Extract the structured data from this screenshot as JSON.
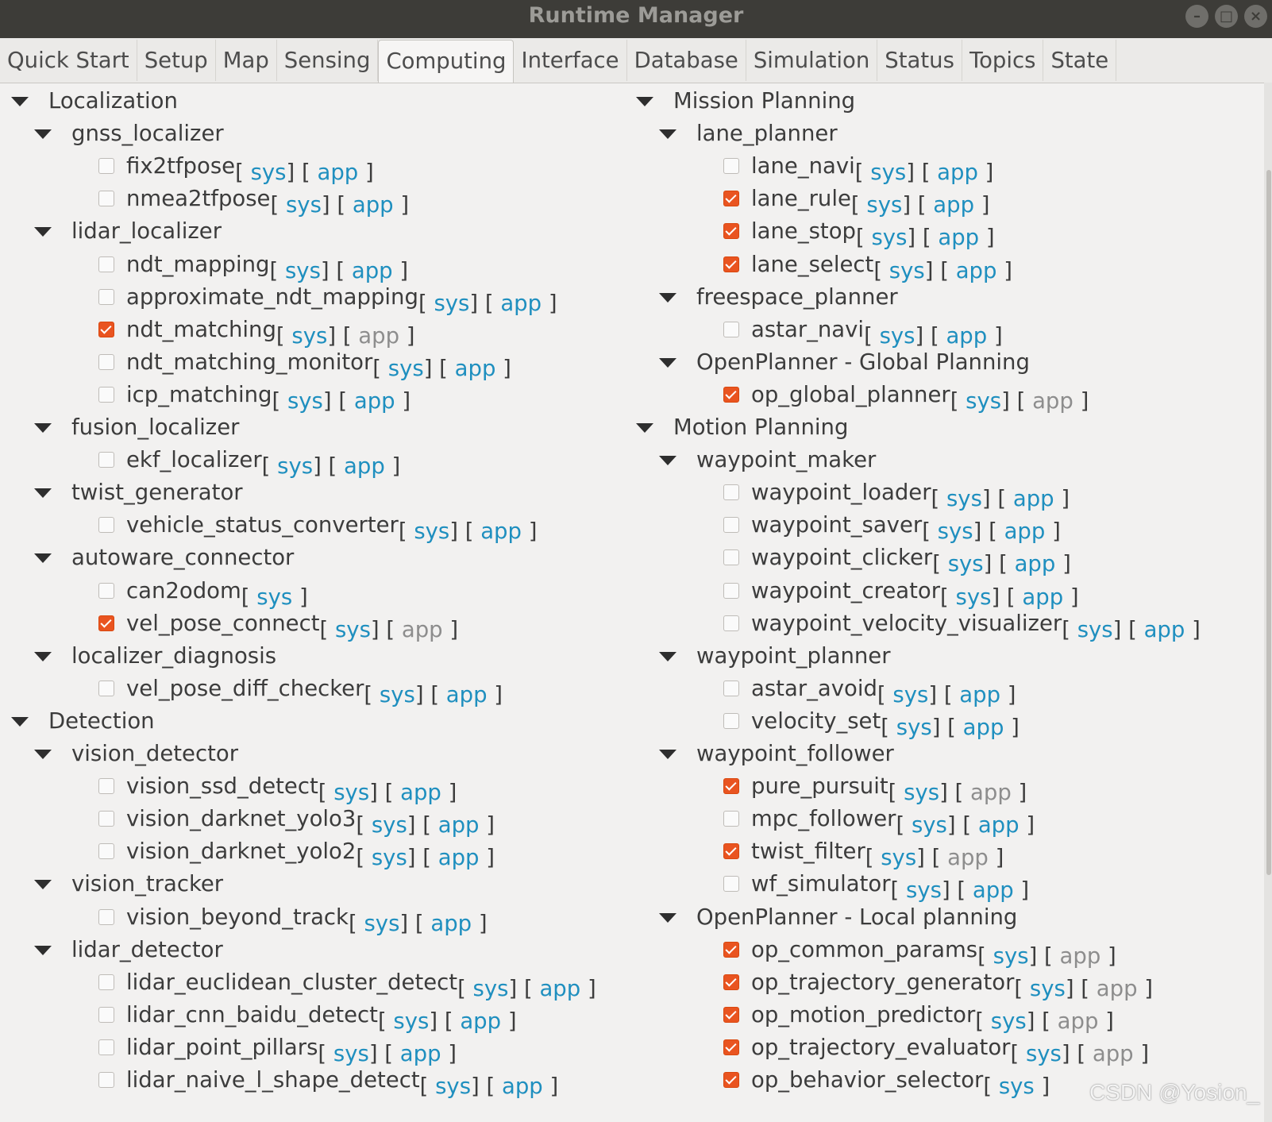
{
  "window": {
    "title": "Runtime Manager",
    "minimize_label": "–",
    "maximize_label": "□",
    "close_label": "×"
  },
  "tabs": [
    "Quick Start",
    "Setup",
    "Map",
    "Sensing",
    "Computing",
    "Interface",
    "Database",
    "Simulation",
    "Status",
    "Topics",
    "State"
  ],
  "active_tab": "Computing",
  "colors": {
    "accent": "#e95420",
    "link": "#1f8fbf",
    "disabled_link": "#8d8d8d",
    "titlebar": "#3d3c38"
  },
  "icons": {
    "expander": "triangle-down-icon",
    "checkbox": "checkbox-icon"
  },
  "watermark": "CSDN @Yosion_",
  "left_tree": [
    {
      "type": "cat",
      "label": "Localization"
    },
    {
      "type": "group",
      "label": "gnss_localizer"
    },
    {
      "type": "item",
      "label": "fix2tfpose",
      "checked": false,
      "links": [
        {
          "t": "sys",
          "on": true
        },
        {
          "t": "app",
          "on": true
        }
      ]
    },
    {
      "type": "item",
      "label": "nmea2tfpose",
      "checked": false,
      "links": [
        {
          "t": "sys",
          "on": true
        },
        {
          "t": "app",
          "on": true
        }
      ]
    },
    {
      "type": "group",
      "label": "lidar_localizer"
    },
    {
      "type": "item",
      "label": "ndt_mapping",
      "checked": false,
      "links": [
        {
          "t": "sys",
          "on": true
        },
        {
          "t": "app",
          "on": true
        }
      ]
    },
    {
      "type": "item",
      "label": "approximate_ndt_mapping",
      "checked": false,
      "links": [
        {
          "t": "sys",
          "on": true
        },
        {
          "t": "app",
          "on": true
        }
      ]
    },
    {
      "type": "item",
      "label": "ndt_matching",
      "checked": true,
      "links": [
        {
          "t": "sys",
          "on": true
        },
        {
          "t": "app",
          "on": false
        }
      ]
    },
    {
      "type": "item",
      "label": "ndt_matching_monitor",
      "checked": false,
      "links": [
        {
          "t": "sys",
          "on": true
        },
        {
          "t": "app",
          "on": true
        }
      ]
    },
    {
      "type": "item",
      "label": "icp_matching",
      "checked": false,
      "links": [
        {
          "t": "sys",
          "on": true
        },
        {
          "t": "app",
          "on": true
        }
      ]
    },
    {
      "type": "group",
      "label": "fusion_localizer"
    },
    {
      "type": "item",
      "label": "ekf_localizer",
      "checked": false,
      "links": [
        {
          "t": "sys",
          "on": true
        },
        {
          "t": "app",
          "on": true
        }
      ]
    },
    {
      "type": "group",
      "label": "twist_generator"
    },
    {
      "type": "item",
      "label": "vehicle_status_converter",
      "checked": false,
      "links": [
        {
          "t": "sys",
          "on": true
        },
        {
          "t": "app",
          "on": true
        }
      ]
    },
    {
      "type": "group",
      "label": "autoware_connector"
    },
    {
      "type": "item",
      "label": "can2odom",
      "checked": false,
      "links": [
        {
          "t": "sys",
          "on": true
        }
      ]
    },
    {
      "type": "item",
      "label": "vel_pose_connect",
      "checked": true,
      "links": [
        {
          "t": "sys",
          "on": true
        },
        {
          "t": "app",
          "on": false
        }
      ]
    },
    {
      "type": "group",
      "label": "localizer_diagnosis"
    },
    {
      "type": "item",
      "label": "vel_pose_diff_checker",
      "checked": false,
      "links": [
        {
          "t": "sys",
          "on": true
        },
        {
          "t": "app",
          "on": true
        }
      ]
    },
    {
      "type": "cat",
      "label": "Detection"
    },
    {
      "type": "group",
      "label": "vision_detector"
    },
    {
      "type": "item",
      "label": "vision_ssd_detect",
      "checked": false,
      "links": [
        {
          "t": "sys",
          "on": true
        },
        {
          "t": "app",
          "on": true
        }
      ]
    },
    {
      "type": "item",
      "label": "vision_darknet_yolo3",
      "checked": false,
      "links": [
        {
          "t": "sys",
          "on": true
        },
        {
          "t": "app",
          "on": true
        }
      ]
    },
    {
      "type": "item",
      "label": "vision_darknet_yolo2",
      "checked": false,
      "links": [
        {
          "t": "sys",
          "on": true
        },
        {
          "t": "app",
          "on": true
        }
      ]
    },
    {
      "type": "group",
      "label": "vision_tracker"
    },
    {
      "type": "item",
      "label": "vision_beyond_track",
      "checked": false,
      "links": [
        {
          "t": "sys",
          "on": true
        },
        {
          "t": "app",
          "on": true
        }
      ]
    },
    {
      "type": "group",
      "label": "lidar_detector"
    },
    {
      "type": "item",
      "label": "lidar_euclidean_cluster_detect",
      "checked": false,
      "links": [
        {
          "t": "sys",
          "on": true
        },
        {
          "t": "app",
          "on": true
        }
      ]
    },
    {
      "type": "item",
      "label": "lidar_cnn_baidu_detect",
      "checked": false,
      "links": [
        {
          "t": "sys",
          "on": true
        },
        {
          "t": "app",
          "on": true
        }
      ]
    },
    {
      "type": "item",
      "label": "lidar_point_pillars",
      "checked": false,
      "links": [
        {
          "t": "sys",
          "on": true
        },
        {
          "t": "app",
          "on": true
        }
      ]
    },
    {
      "type": "item",
      "label": "lidar_naive_l_shape_detect",
      "checked": false,
      "links": [
        {
          "t": "sys",
          "on": true
        },
        {
          "t": "app",
          "on": true
        }
      ]
    }
  ],
  "right_tree": [
    {
      "type": "cat",
      "label": "Mission Planning"
    },
    {
      "type": "group",
      "label": "lane_planner"
    },
    {
      "type": "item",
      "label": "lane_navi",
      "checked": false,
      "links": [
        {
          "t": "sys",
          "on": true
        },
        {
          "t": "app",
          "on": true
        }
      ]
    },
    {
      "type": "item",
      "label": "lane_rule",
      "checked": true,
      "links": [
        {
          "t": "sys",
          "on": true
        },
        {
          "t": "app",
          "on": true
        }
      ]
    },
    {
      "type": "item",
      "label": "lane_stop",
      "checked": true,
      "links": [
        {
          "t": "sys",
          "on": true
        },
        {
          "t": "app",
          "on": true
        }
      ]
    },
    {
      "type": "item",
      "label": "lane_select",
      "checked": true,
      "links": [
        {
          "t": "sys",
          "on": true
        },
        {
          "t": "app",
          "on": true
        }
      ]
    },
    {
      "type": "group",
      "label": "freespace_planner"
    },
    {
      "type": "item",
      "label": "astar_navi",
      "checked": false,
      "links": [
        {
          "t": "sys",
          "on": true
        },
        {
          "t": "app",
          "on": true
        }
      ]
    },
    {
      "type": "group",
      "label": "OpenPlanner - Global Planning"
    },
    {
      "type": "item",
      "label": "op_global_planner",
      "checked": true,
      "links": [
        {
          "t": "sys",
          "on": true
        },
        {
          "t": "app",
          "on": false
        }
      ]
    },
    {
      "type": "cat",
      "label": "Motion Planning"
    },
    {
      "type": "group",
      "label": "waypoint_maker"
    },
    {
      "type": "item",
      "label": "waypoint_loader",
      "checked": false,
      "links": [
        {
          "t": "sys",
          "on": true
        },
        {
          "t": "app",
          "on": true
        }
      ]
    },
    {
      "type": "item",
      "label": "waypoint_saver",
      "checked": false,
      "links": [
        {
          "t": "sys",
          "on": true
        },
        {
          "t": "app",
          "on": true
        }
      ]
    },
    {
      "type": "item",
      "label": "waypoint_clicker",
      "checked": false,
      "links": [
        {
          "t": "sys",
          "on": true
        },
        {
          "t": "app",
          "on": true
        }
      ]
    },
    {
      "type": "item",
      "label": "waypoint_creator",
      "checked": false,
      "links": [
        {
          "t": "sys",
          "on": true
        },
        {
          "t": "app",
          "on": true
        }
      ]
    },
    {
      "type": "item",
      "label": "waypoint_velocity_visualizer",
      "checked": false,
      "links": [
        {
          "t": "sys",
          "on": true
        },
        {
          "t": "app",
          "on": true
        }
      ]
    },
    {
      "type": "group",
      "label": "waypoint_planner"
    },
    {
      "type": "item",
      "label": "astar_avoid",
      "checked": false,
      "links": [
        {
          "t": "sys",
          "on": true
        },
        {
          "t": "app",
          "on": true
        }
      ]
    },
    {
      "type": "item",
      "label": "velocity_set",
      "checked": false,
      "links": [
        {
          "t": "sys",
          "on": true
        },
        {
          "t": "app",
          "on": true
        }
      ]
    },
    {
      "type": "group",
      "label": "waypoint_follower"
    },
    {
      "type": "item",
      "label": "pure_pursuit",
      "checked": true,
      "links": [
        {
          "t": "sys",
          "on": true
        },
        {
          "t": "app",
          "on": false
        }
      ]
    },
    {
      "type": "item",
      "label": "mpc_follower",
      "checked": false,
      "links": [
        {
          "t": "sys",
          "on": true
        },
        {
          "t": "app",
          "on": true
        }
      ]
    },
    {
      "type": "item",
      "label": "twist_filter",
      "checked": true,
      "links": [
        {
          "t": "sys",
          "on": true
        },
        {
          "t": "app",
          "on": false
        }
      ]
    },
    {
      "type": "item",
      "label": "wf_simulator",
      "checked": false,
      "links": [
        {
          "t": "sys",
          "on": true
        },
        {
          "t": "app",
          "on": true
        }
      ]
    },
    {
      "type": "group",
      "label": "OpenPlanner - Local planning"
    },
    {
      "type": "item",
      "label": "op_common_params",
      "checked": true,
      "links": [
        {
          "t": "sys",
          "on": true
        },
        {
          "t": "app",
          "on": false
        }
      ]
    },
    {
      "type": "item",
      "label": "op_trajectory_generator",
      "checked": true,
      "links": [
        {
          "t": "sys",
          "on": true
        },
        {
          "t": "app",
          "on": false
        }
      ]
    },
    {
      "type": "item",
      "label": "op_motion_predictor",
      "checked": true,
      "links": [
        {
          "t": "sys",
          "on": true
        },
        {
          "t": "app",
          "on": false
        }
      ]
    },
    {
      "type": "item",
      "label": "op_trajectory_evaluator",
      "checked": true,
      "links": [
        {
          "t": "sys",
          "on": true
        },
        {
          "t": "app",
          "on": false
        }
      ]
    },
    {
      "type": "item",
      "label": "op_behavior_selector",
      "checked": true,
      "links": [
        {
          "t": "sys",
          "on": true
        }
      ]
    }
  ]
}
